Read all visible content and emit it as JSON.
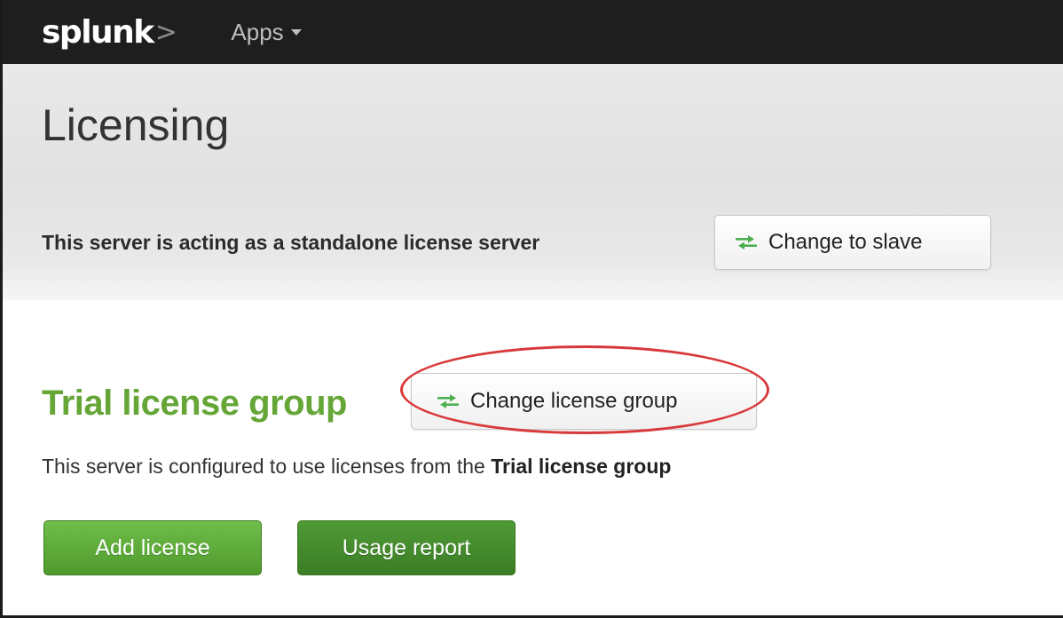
{
  "nav": {
    "logo_text": "splunk",
    "logo_mark": ">",
    "apps_label": "Apps"
  },
  "header": {
    "title": "Licensing"
  },
  "server": {
    "status_text": "This server is acting as a standalone license server",
    "change_button_label": "Change to slave"
  },
  "license_group": {
    "title": "Trial license group",
    "change_button_label": "Change license group",
    "description_prefix": "This server is configured to use licenses from the ",
    "description_group": "Trial license group",
    "add_button_label": "Add license",
    "usage_button_label": "Usage report"
  },
  "colors": {
    "brand_green": "#65a637",
    "nav_bg": "#1e1e1e",
    "highlight_red": "#d9383a"
  },
  "icons": {
    "change_icon": "swap-arrows-icon",
    "apps_caret": "caret-down-icon"
  }
}
